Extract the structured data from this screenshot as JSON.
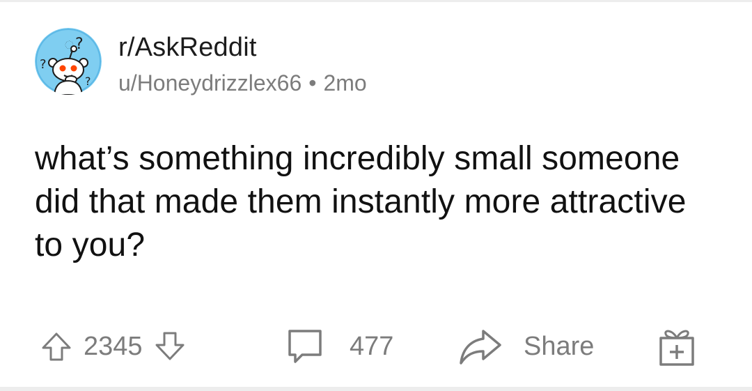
{
  "post": {
    "subreddit": "r/AskReddit",
    "author": "u/Honeydrizzlex66",
    "separator": "•",
    "age": "2mo",
    "title": "what’s something incredibly small someone did that made them instantly more attractive to you?"
  },
  "actions": {
    "upvote_icon": "arrow-up-outline-icon",
    "downvote_icon": "arrow-down-outline-icon",
    "vote_count": "2345",
    "comment_icon": "speech-bubble-icon",
    "comment_count": "477",
    "share_icon": "share-arrow-icon",
    "share_label": "Share",
    "award_icon": "gift-box-plus-icon"
  },
  "colors": {
    "text_primary": "#1c1c1c",
    "text_secondary": "#7c7c7c",
    "avatar_bg": "#7fcef1",
    "avatar_eyes": "#ff4500",
    "icon_stroke": "#7c7c7c"
  }
}
